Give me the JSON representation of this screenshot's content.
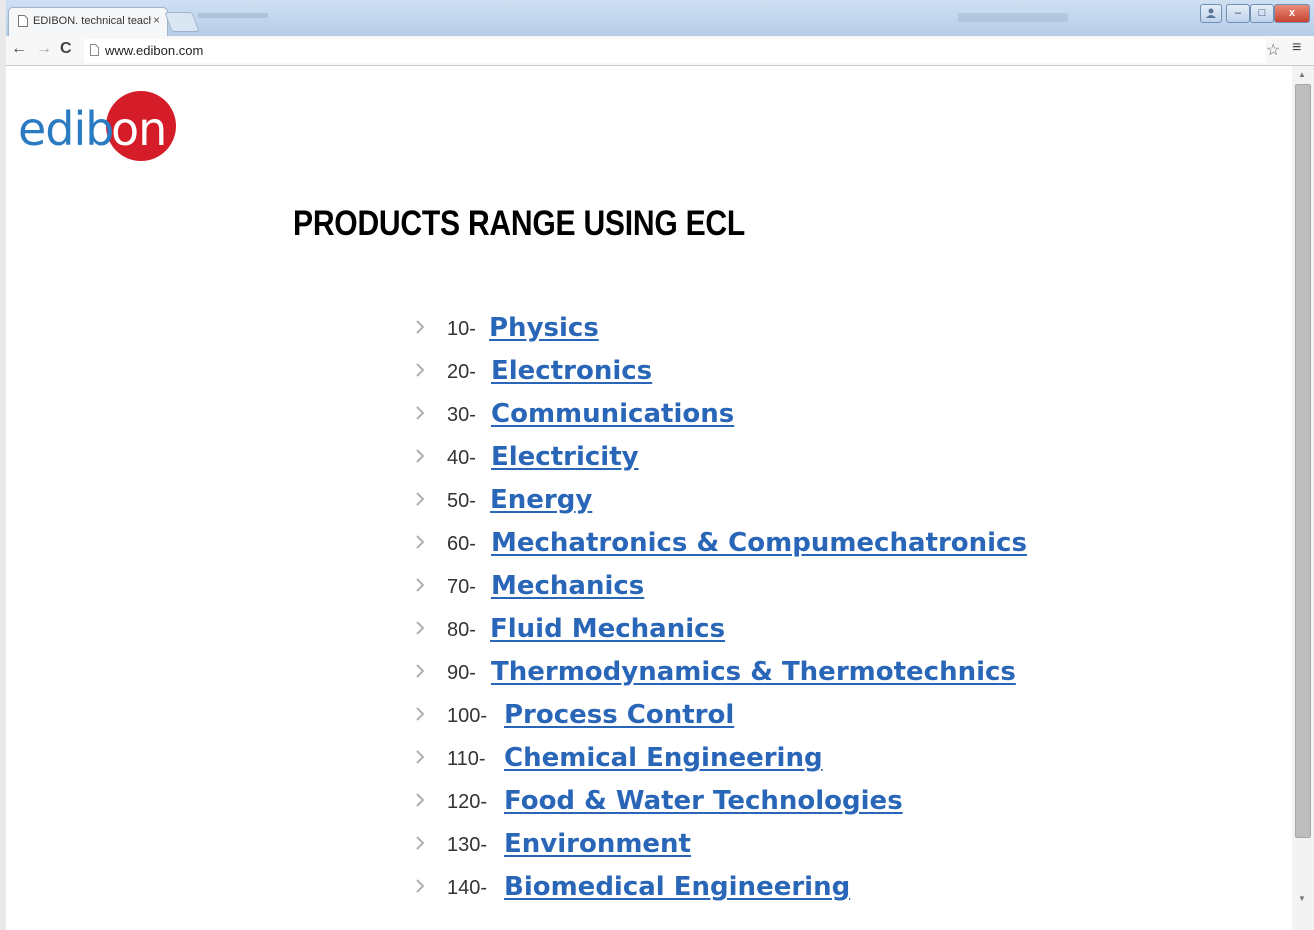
{
  "browser": {
    "tab_title": "EDIBON. technical teachi",
    "tab_close": "×",
    "url": "www.edibon.com",
    "window_buttons": {
      "minimize": "–",
      "maximize": "□",
      "close": "x"
    }
  },
  "page": {
    "logo_text": "edibon",
    "title": "PRODUCTS RANGE USING ECL",
    "products": [
      {
        "number": "10-",
        "label": "Physics"
      },
      {
        "number": "20-",
        "label": "Electronics"
      },
      {
        "number": "30-",
        "label": "Communications"
      },
      {
        "number": "40-",
        "label": "Electricity"
      },
      {
        "number": "50-",
        "label": "Energy"
      },
      {
        "number": "60-",
        "label": "Mechatronics & Compumechatronics"
      },
      {
        "number": "70-",
        "label": "Mechanics"
      },
      {
        "number": "80-",
        "label": "Fluid Mechanics"
      },
      {
        "number": "90-",
        "label": "Thermodynamics & Thermotechnics"
      },
      {
        "number": "100-",
        "label": "Process Control"
      },
      {
        "number": "110-",
        "label": "Chemical Engineering"
      },
      {
        "number": "120-",
        "label": "Food & Water Technologies"
      },
      {
        "number": "130-",
        "label": "Environment"
      },
      {
        "number": "140-",
        "label": "Biomedical Engineering"
      }
    ]
  },
  "colors": {
    "link": "#2a66b8",
    "logo_blue": "#2a7bc2",
    "logo_red": "#d51d2a"
  }
}
